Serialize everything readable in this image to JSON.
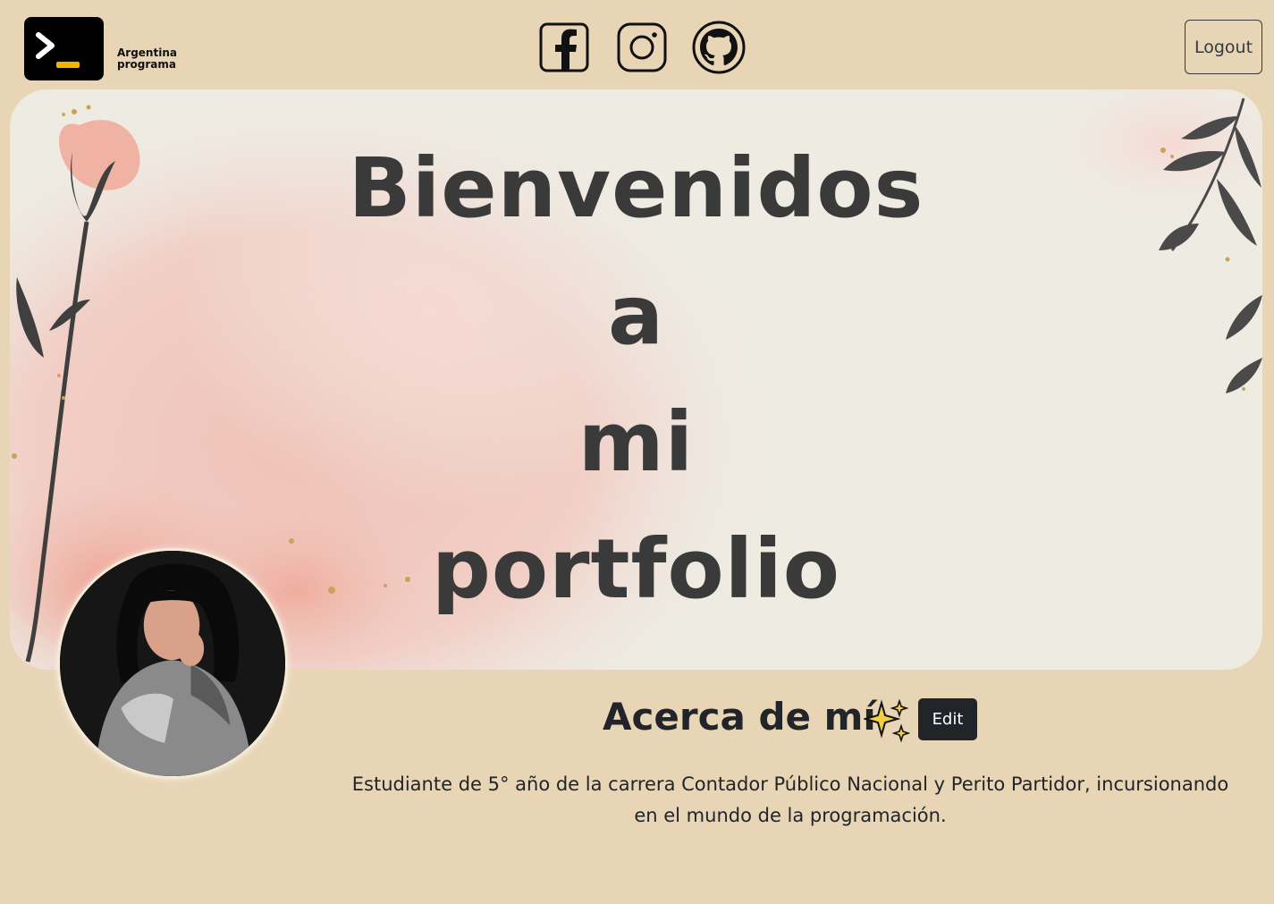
{
  "navbar": {
    "logo_line1": "Argentina",
    "logo_line2": "programa",
    "logo_icon": "terminal-prompt-icon",
    "social_icons": [
      "facebook-icon",
      "instagram-icon",
      "github-icon"
    ],
    "logout_label": "Logout"
  },
  "banner": {
    "title_lines": [
      "Bienvenidos",
      "a",
      "mi",
      "portfolio"
    ],
    "decor": [
      "watercolor-flower",
      "leaf-branch"
    ]
  },
  "about": {
    "title": "Acerca de mí",
    "title_icon": "sparkles-icon",
    "edit_label": "Edit",
    "description": "Estudiante de 5° año de la carrera Contador Público Nacional y Perito Partidor, incursionando en el mundo de la programación."
  },
  "colors": {
    "page_background": "#e8d5b5",
    "banner_background": "#eeebe3",
    "watercolor_pink": "#f0b8ac",
    "logo_accent": "#f5b301",
    "dark_button": "#212529"
  }
}
